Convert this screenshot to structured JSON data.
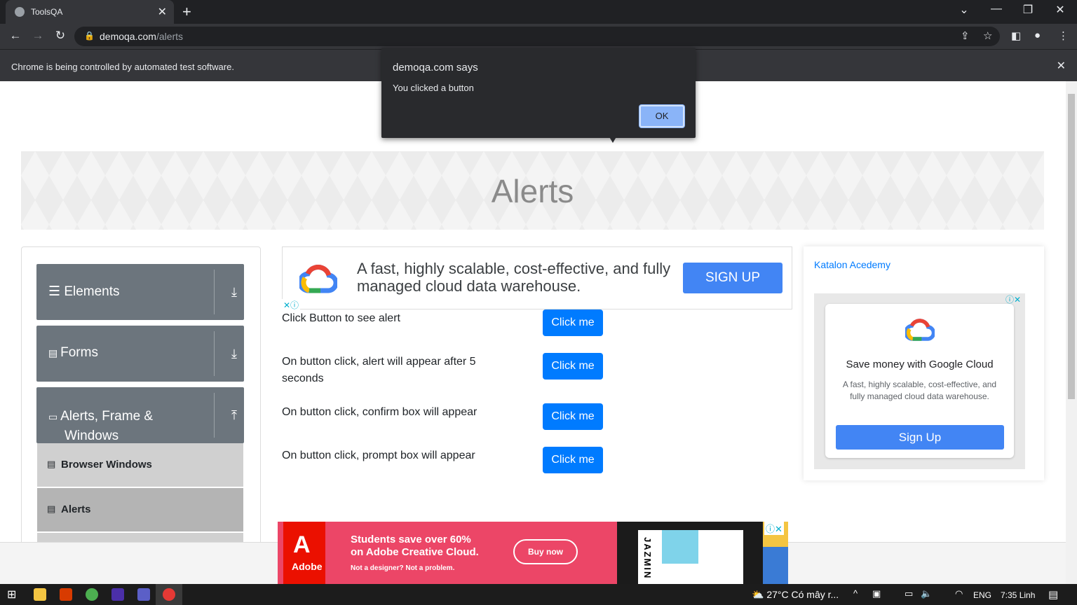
{
  "browser": {
    "tab_title": "ToolsQA",
    "url_host": "demoqa.com",
    "url_path": "/alerts",
    "automation_message": "Chrome is being controlled by automated test software."
  },
  "dialog": {
    "title": "demoqa.com says",
    "message": "You clicked a button",
    "ok_label": "OK"
  },
  "page": {
    "heading": "Alerts",
    "sidebar": {
      "groups": [
        {
          "label": "Elements"
        },
        {
          "label": "Forms"
        },
        {
          "label": "Alerts, Frame &",
          "label2": "Windows"
        }
      ],
      "items": [
        {
          "label": "Browser Windows"
        },
        {
          "label": "Alerts"
        }
      ]
    },
    "rows": [
      {
        "text": "Click Button to see alert",
        "button": "Click me"
      },
      {
        "text": "On button click, alert will appear after 5 seconds",
        "button": "Click me"
      },
      {
        "text": "On button click, confirm box will appear",
        "button": "Click me"
      },
      {
        "text": "On button click, prompt box will appear",
        "button": "Click me"
      }
    ]
  },
  "ads": {
    "top": {
      "copy": "A fast, highly scalable, cost-effective, and fully managed cloud data warehouse.",
      "cta": "SIGN UP"
    },
    "right": {
      "katalon_alt": "Katalon Acedemy",
      "headline": "Save money with Google Cloud",
      "body": "A fast, highly scalable, cost-effective, and fully managed cloud data warehouse.",
      "cta": "Sign Up"
    },
    "bottom": {
      "brand": "Adobe",
      "headline1": "Students save over 60%",
      "headline2": "on Adobe Creative Cloud.",
      "sub": "Not a designer? Not a problem.",
      "cta": "Buy now",
      "side_text": "JAZMIN"
    }
  },
  "taskbar": {
    "weather": "27°C  Có mây r...",
    "lang": "ENG",
    "clock": "7:35 Linh"
  },
  "colors": {
    "primary_button": "#007bff",
    "sidebar_group": "#6c757d",
    "google_blue": "#4285f4"
  }
}
